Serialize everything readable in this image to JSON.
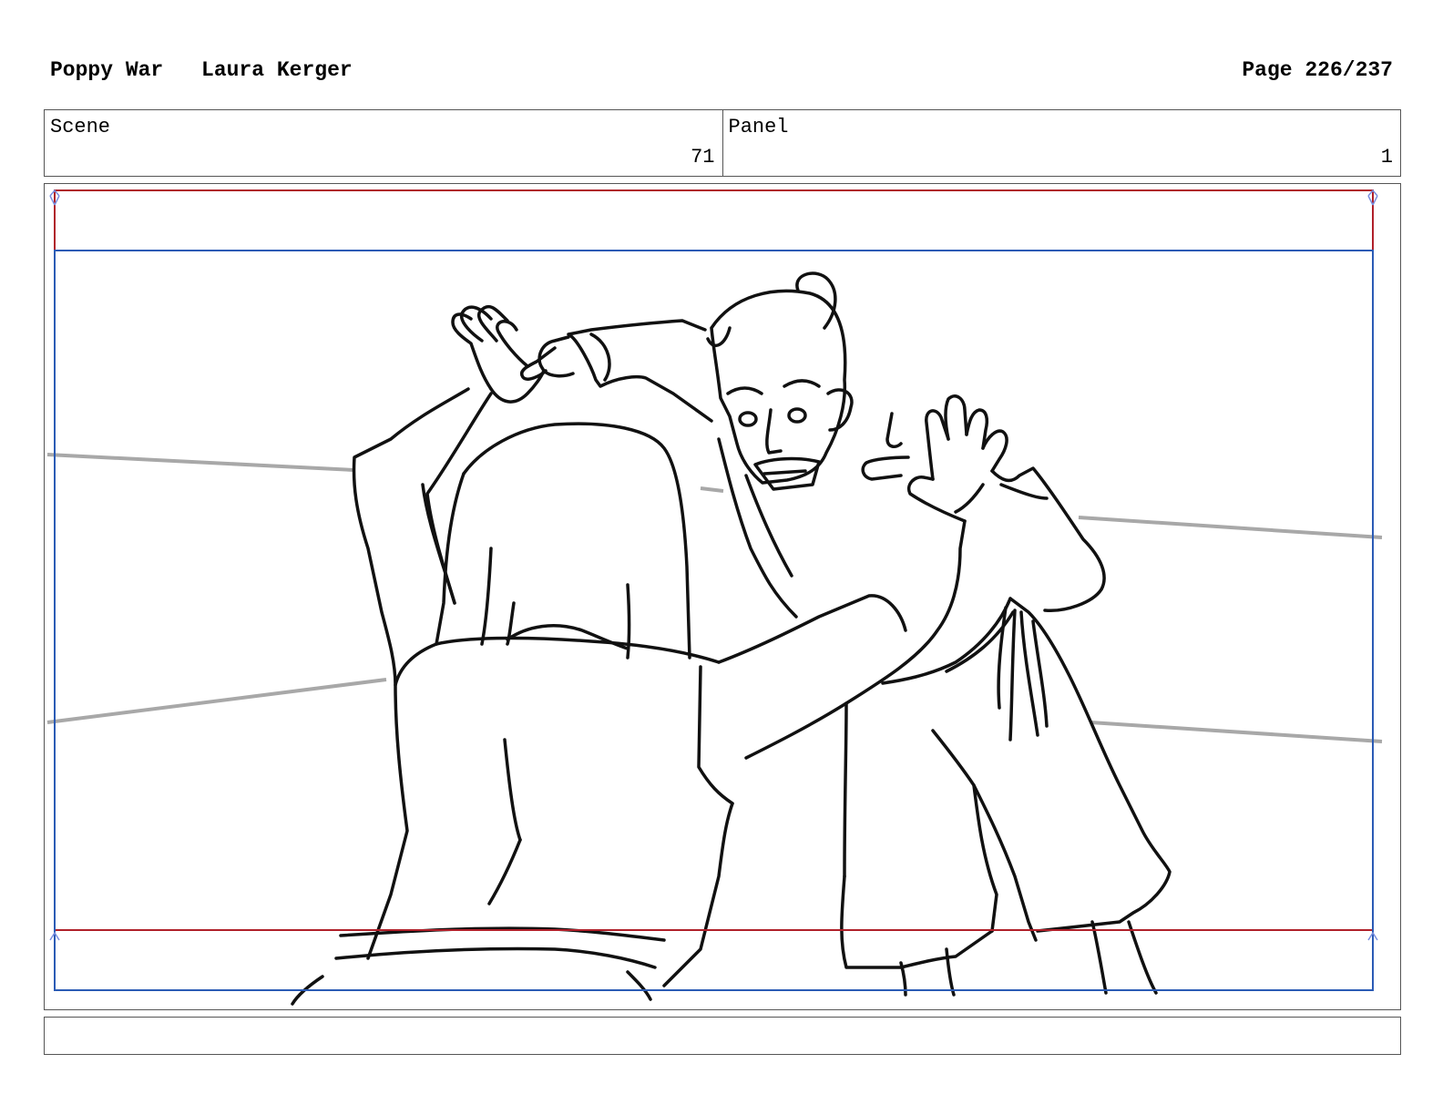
{
  "header": {
    "project": "Poppy War",
    "author": "Laura Kerger",
    "page": "Page 226/237"
  },
  "scene": {
    "label": "Scene",
    "value": "71"
  },
  "panel": {
    "label": "Panel",
    "value": "1"
  },
  "notes": {
    "text": ""
  },
  "colors": {
    "safe_frame": "#b0202a",
    "camera_frame": "#2b5bb5",
    "background_lines": "#a8a8a8",
    "ink": "#111111"
  }
}
